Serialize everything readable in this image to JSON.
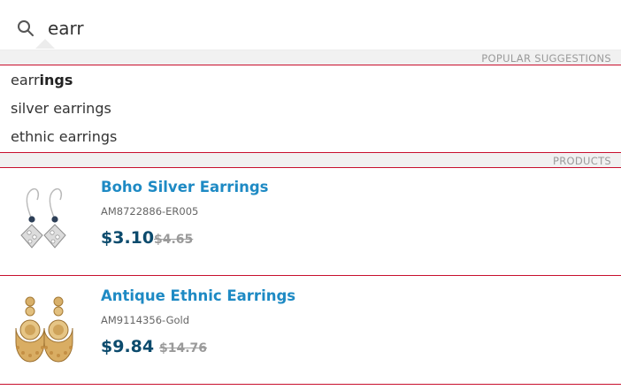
{
  "search": {
    "icon": "search-icon",
    "query": "earr"
  },
  "suggestions": {
    "header": "POPULAR SUGGESTIONS",
    "items": [
      {
        "match": "earr",
        "rest": "ings"
      },
      {
        "text": "silver earrings"
      },
      {
        "text": "ethnic earrings"
      }
    ]
  },
  "products": {
    "header": "PRODUCTS",
    "items": [
      {
        "title": "Boho Silver Earrings",
        "sku": "AM8722886-ER005",
        "price": "$3.10",
        "old_price": "$4.65",
        "image_icon": "silver-earrings-image"
      },
      {
        "title": "Antique Ethnic Earrings",
        "sku": "AM9114356-Gold",
        "price": "$9.84",
        "old_price": "$14.76",
        "image_icon": "gold-earrings-image"
      }
    ]
  },
  "colors": {
    "accent_red": "#c8102e",
    "title_blue": "#1e8ac4",
    "price_navy": "#0c4b6d"
  }
}
